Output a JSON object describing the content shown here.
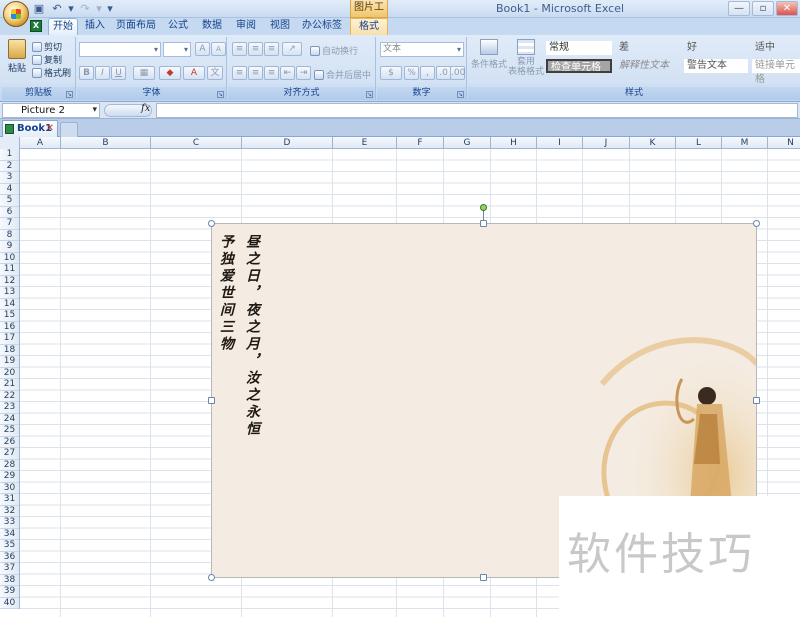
{
  "titlebar": {
    "app_title": "Book1 - Microsoft Excel",
    "context_tab_title": "图片工具",
    "window_controls": [
      "minimize-icon",
      "maximize-icon",
      "close-icon"
    ]
  },
  "tabs": [
    {
      "label": "开始",
      "active": true
    },
    {
      "label": "插入"
    },
    {
      "label": "页面布局"
    },
    {
      "label": "公式"
    },
    {
      "label": "数据"
    },
    {
      "label": "审阅"
    },
    {
      "label": "视图"
    },
    {
      "label": "办公标签"
    },
    {
      "label": "格式",
      "contextual": true
    }
  ],
  "ribbon": {
    "clipboard": {
      "paste": "粘贴",
      "cut": "剪切",
      "copy": "复制",
      "format_painter": "格式刷",
      "label": "剪贴板"
    },
    "font": {
      "label": "字体",
      "bold": "B",
      "italic": "I",
      "underline": "U",
      "grow": "A",
      "shrink": "A"
    },
    "alignment": {
      "wrap_text": "自动换行",
      "merge_center": "合并后居中",
      "label": "对齐方式"
    },
    "number": {
      "format": "文本",
      "percent": "%",
      "comma": ",",
      "label": "数字"
    },
    "styles": {
      "conditional_formatting": "条件格式",
      "format_as_table": "套用\n表格格式",
      "cells": [
        {
          "label": "常规"
        },
        {
          "label": "差"
        },
        {
          "label": "好"
        },
        {
          "label": "适中"
        },
        {
          "label": "检查单元格"
        },
        {
          "label": "解释性文本"
        },
        {
          "label": "警告文本"
        },
        {
          "label": "链接单元格"
        }
      ],
      "label": "样式"
    }
  },
  "formula_bar": {
    "name_box": "Picture 2",
    "fx": "fx",
    "formula": ""
  },
  "workbook_tab": {
    "label": "Book1"
  },
  "grid": {
    "columns": [
      "A",
      "B",
      "C",
      "D",
      "E",
      "F",
      "G",
      "H",
      "I",
      "J",
      "K",
      "L",
      "M",
      "N"
    ],
    "rows": [
      "1",
      "2",
      "3",
      "4",
      "5",
      "6",
      "7",
      "8",
      "9",
      "10",
      "11",
      "12",
      "13",
      "14",
      "15",
      "16",
      "17",
      "18",
      "19",
      "20",
      "21",
      "22",
      "23",
      "24",
      "25",
      "26",
      "27",
      "28",
      "29",
      "30",
      "31",
      "32",
      "33",
      "34",
      "35",
      "36",
      "37",
      "38",
      "39",
      "40"
    ]
  },
  "picture": {
    "poem_lines": [
      "予独爱世间三物",
      "昼之日，夜之月，汝之永恒"
    ]
  },
  "watermark": "软件技巧"
}
